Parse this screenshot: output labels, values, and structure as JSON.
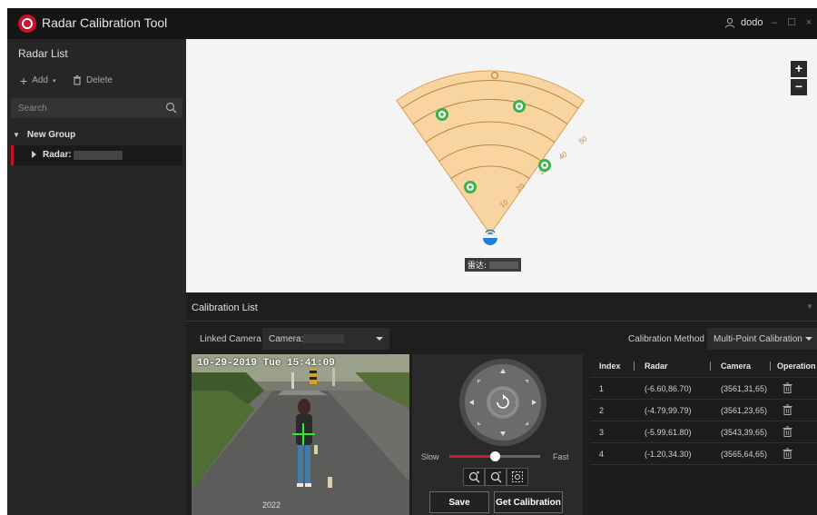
{
  "app": {
    "title": "Radar Calibration Tool",
    "user": "dodo",
    "window_controls": [
      "–",
      "☐",
      "×"
    ]
  },
  "sidebar": {
    "title": "Radar List",
    "add_label": "Add",
    "delete_label": "Delete",
    "search_placeholder": "Search",
    "group_label": "New Group",
    "radar_label": "Radar:"
  },
  "map": {
    "radar_label": "雷达:",
    "distance_labels": [
      "10",
      "20",
      "30",
      "40",
      "50"
    ],
    "zoom_in": "+",
    "zoom_out": "−"
  },
  "calibration": {
    "title": "Calibration List",
    "linked_camera_label": "Linked Camera",
    "camera_value": "Camera:",
    "method_label": "Calibration Method",
    "method_value": "Multi-Point Calibration"
  },
  "video": {
    "osd": "10-29-2019 Tue 15:41:09",
    "tag": "2022"
  },
  "ptz": {
    "slow_label": "Slow",
    "fast_label": "Fast",
    "speed_fraction": 0.5,
    "save_label": "Save",
    "get_calibration_label": "Get Calibration"
  },
  "table": {
    "headers": [
      "Index",
      "Radar",
      "Camera",
      "Operation"
    ],
    "rows": [
      {
        "index": "1",
        "radar": "(-6.60,86.70)",
        "camera": "(3561,31,65)"
      },
      {
        "index": "2",
        "radar": "(-4.79,99.79)",
        "camera": "(3561,23,65)"
      },
      {
        "index": "3",
        "radar": "(-5.99,61.80)",
        "camera": "(3543,39,65)"
      },
      {
        "index": "4",
        "radar": "(-1.20,34.30)",
        "camera": "(3565,64,65)"
      }
    ]
  },
  "colors": {
    "accent": "#c8102e",
    "sector_fill": "#f7d4a0",
    "sector_stroke": "#d9a05a",
    "target_green": "#3cb34a",
    "radar_blue": "#1e7fd8"
  }
}
